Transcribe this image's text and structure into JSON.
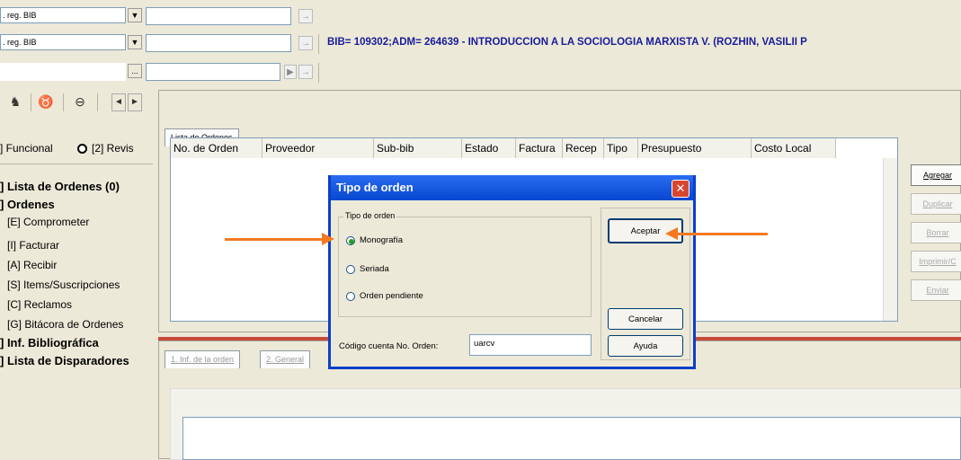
{
  "top_rows": [
    {
      "combo": ". reg. BIB",
      "dropdown": "▼",
      "go": "→",
      "info": ""
    },
    {
      "combo": ". reg. BIB",
      "dropdown": "▼",
      "go": "→",
      "info": "BIB= 109302;ADM= 264639 - INTRODUCCION A LA SOCIOLOGIA MARXISTA V. (ROZHIN, VASILII P"
    },
    {
      "combo": "",
      "dropdown": "...",
      "go": "→",
      "info": ""
    }
  ],
  "toolbar": {
    "icons": [
      "♞",
      "♉",
      "⊖",
      "◄",
      "►"
    ]
  },
  "left_panel": {
    "radio1_label": "] Funcional",
    "radio2_label": "[2] Revis",
    "items": [
      {
        "text": "] Lista de Ordenes (0)",
        "bold": true
      },
      {
        "text": "] Ordenes",
        "bold": true
      },
      {
        "text": "[E] Comprometer",
        "bold": false
      },
      {
        "text": "[I] Facturar",
        "bold": false
      },
      {
        "text": "[A] Recibir",
        "bold": false
      },
      {
        "text": "[S] Items/Suscripciones",
        "bold": false
      },
      {
        "text": "[C] Reclamos",
        "bold": false
      },
      {
        "text": "[G] Bitácora de Ordenes",
        "bold": false
      },
      {
        "text": "] Inf. Bibliográfica",
        "bold": true
      },
      {
        "text": "] Lista de Disparadores",
        "bold": true
      }
    ]
  },
  "orders": {
    "tab_label": "Lista de Ordenes",
    "columns": [
      "No. de Orden",
      "Proveedor",
      "Sub-bib",
      "Estado",
      "Factura",
      "Recep",
      "Tipo",
      "Presupuesto",
      "Costo Local"
    ],
    "buttons": [
      "Agregar",
      "Duplicar",
      "Borrar",
      "Imprimir/C",
      "Enviar"
    ]
  },
  "detail_tabs": [
    "1. Inf. de la orden",
    "2. General"
  ],
  "dialog": {
    "title": "Tipo de orden",
    "group_label": "Tipo de orden",
    "options": [
      "Monografía",
      "Seriada",
      "Orden pendiente"
    ],
    "selected": 0,
    "accept": "Aceptar",
    "cancel": "Cancelar",
    "help": "Ayuda",
    "code_label": "Código cuenta No. Orden:",
    "code_value": "uarcv"
  },
  "colors": {
    "arrow": "#f47920",
    "title_blue": "#1a1a9c",
    "dialog_title": "#0747d0"
  }
}
